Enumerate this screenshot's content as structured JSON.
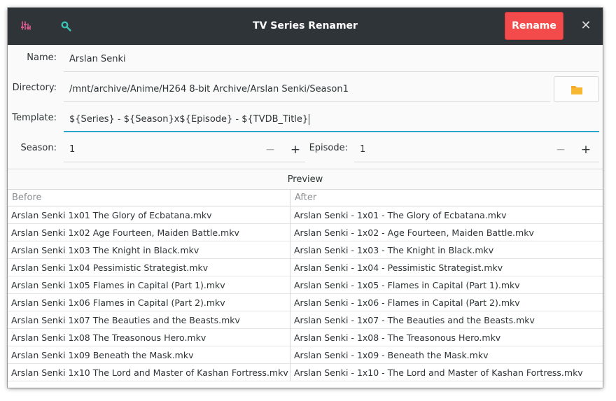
{
  "window": {
    "title": "TV Series Renamer",
    "rename_label": "Rename",
    "close_glyph": "✕",
    "icons": [
      "equalizer-icon",
      "search-icon",
      "close-icon",
      "folder-icon"
    ]
  },
  "form": {
    "name_label": "Name:",
    "name_value": "Arslan Senki",
    "directory_label": "Directory:",
    "directory_value": "/mnt/archive/Anime/H264 8-bit Archive/Arslan Senki/Season1",
    "template_label": "Template:",
    "template_value": "${Series} - ${Season}x${Episode} - ${TVDB_Title}",
    "season_label": "Season:",
    "season_value": "1",
    "episode_label": "Episode:",
    "episode_value": "1",
    "minus_glyph": "−",
    "plus_glyph": "+"
  },
  "preview": {
    "title": "Preview",
    "columns": [
      "Before",
      "After"
    ],
    "rows": [
      [
        "Arslan Senki 1x01 The Glory of Ecbatana.mkv",
        "Arslan Senki - 1x01 - The Glory of Ecbatana.mkv"
      ],
      [
        "Arslan Senki 1x02 Age Fourteen, Maiden Battle.mkv",
        "Arslan Senki - 1x02 - Age Fourteen, Maiden Battle.mkv"
      ],
      [
        "Arslan Senki 1x03 The Knight in Black.mkv",
        "Arslan Senki - 1x03 - The Knight in Black.mkv"
      ],
      [
        "Arslan Senki 1x04 Pessimistic Strategist.mkv",
        "Arslan Senki - 1x04 - Pessimistic Strategist.mkv"
      ],
      [
        "Arslan Senki 1x05 Flames in Capital (Part 1).mkv",
        "Arslan Senki - 1x05 - Flames in Capital (Part 1).mkv"
      ],
      [
        "Arslan Senki 1x06 Flames in Capital (Part 2).mkv",
        "Arslan Senki - 1x06 - Flames in Capital (Part 2).mkv"
      ],
      [
        "Arslan Senki 1x07 The Beauties and the Beasts.mkv",
        "Arslan Senki - 1x07 - The Beauties and the Beasts.mkv"
      ],
      [
        "Arslan Senki 1x08 The Treasonous Hero.mkv",
        "Arslan Senki - 1x08 - The Treasonous Hero.mkv"
      ],
      [
        "Arslan Senki 1x09 Beneath the Mask.mkv",
        "Arslan Senki - 1x09 - Beneath the Mask.mkv"
      ],
      [
        "Arslan Senki 1x10 The Lord and Master of Kashan Fortress.mkv",
        "Arslan Senki - 1x10 - The Lord and Master of Kashan Fortress.mkv"
      ]
    ]
  },
  "colors": {
    "headerbar": "#2f3438",
    "accent_destructive": "#f34b4b",
    "focus": "#2ba5c9",
    "equalizer_icon": "#e05a92",
    "search_icon": "#3cc2b4",
    "folder_icon": "#f5a623"
  }
}
